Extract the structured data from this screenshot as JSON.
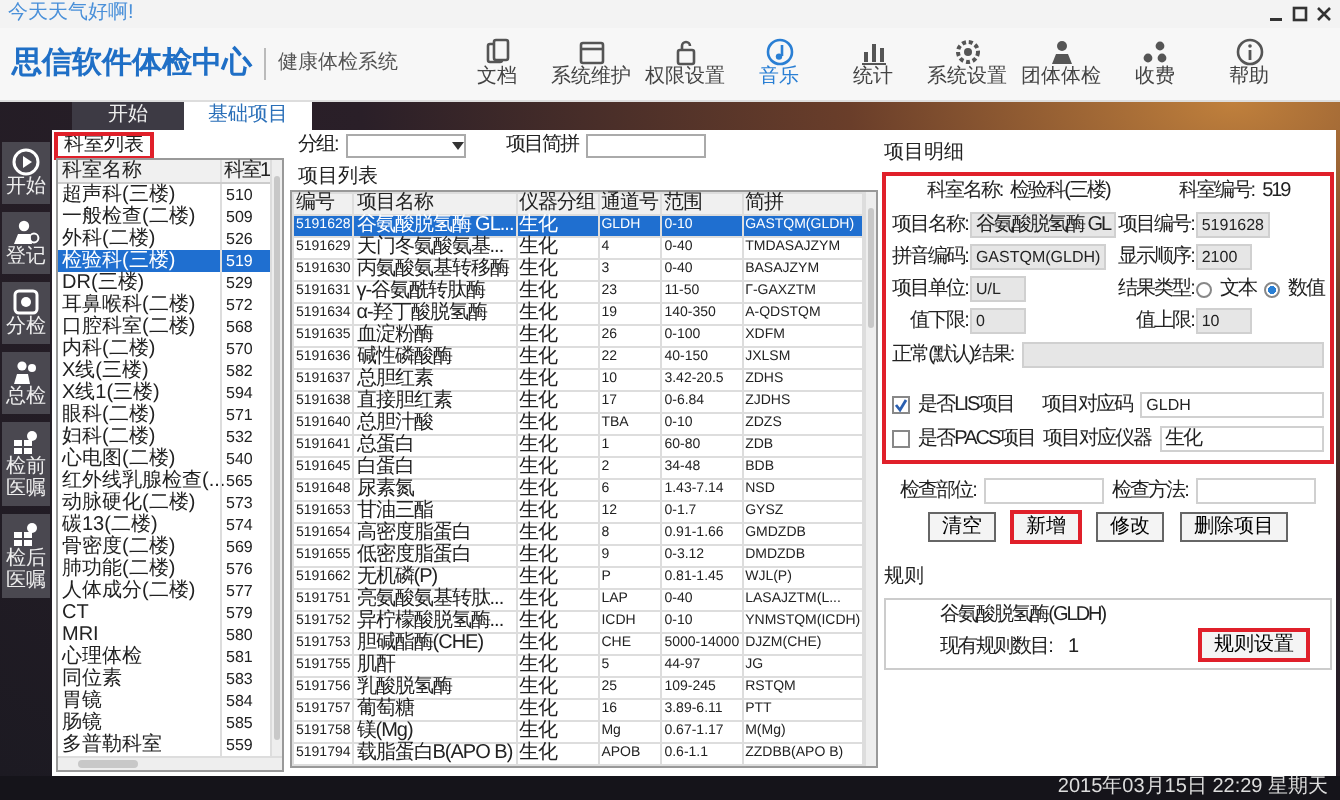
{
  "window": {
    "title": "今天天气好啊!"
  },
  "header": {
    "logo": "思信软件体检中心",
    "subtitle": "健康体检系统"
  },
  "toolbar": [
    {
      "label": "文档",
      "selected": false
    },
    {
      "label": "系统维护",
      "selected": false
    },
    {
      "label": "权限设置",
      "selected": false
    },
    {
      "label": "音乐",
      "selected": true
    },
    {
      "label": "统计",
      "selected": false
    },
    {
      "label": "系统设置",
      "selected": false
    },
    {
      "label": "团体体检",
      "selected": false
    },
    {
      "label": "收费",
      "selected": false
    },
    {
      "label": "帮助",
      "selected": false
    }
  ],
  "tabs": [
    {
      "label": "开始",
      "selected": false
    },
    {
      "label": "基础项目",
      "selected": true
    }
  ],
  "sidebar": [
    {
      "label": "开始"
    },
    {
      "label": "登记"
    },
    {
      "label": "分检"
    },
    {
      "label": "总检"
    },
    {
      "label": "检前医嘱"
    },
    {
      "label": "检后医嘱"
    }
  ],
  "departments": {
    "title": "科室列表",
    "highlighted": true,
    "columns": [
      "科室名称",
      "科室1"
    ],
    "rows": [
      {
        "name": "超声科(三楼)",
        "code": "510",
        "selected": false
      },
      {
        "name": "一般检查(二楼)",
        "code": "509",
        "selected": false
      },
      {
        "name": "外科(二楼)",
        "code": "526",
        "selected": false
      },
      {
        "name": "检验科(三楼)",
        "code": "519",
        "selected": true
      },
      {
        "name": "DR(三楼)",
        "code": "529",
        "selected": false
      },
      {
        "name": "耳鼻喉科(二楼)",
        "code": "572",
        "selected": false
      },
      {
        "name": "口腔科室(二楼)",
        "code": "568",
        "selected": false
      },
      {
        "name": "内科(二楼)",
        "code": "570",
        "selected": false
      },
      {
        "name": "X线(三楼)",
        "code": "582",
        "selected": false
      },
      {
        "name": "X线1(三楼)",
        "code": "594",
        "selected": false
      },
      {
        "name": "眼科(二楼)",
        "code": "571",
        "selected": false
      },
      {
        "name": "妇科(二楼)",
        "code": "532",
        "selected": false
      },
      {
        "name": "心电图(二楼)",
        "code": "540",
        "selected": false
      },
      {
        "name": "红外线乳腺检查(...",
        "code": "565",
        "selected": false
      },
      {
        "name": "动脉硬化(二楼)",
        "code": "573",
        "selected": false
      },
      {
        "name": "碳13(二楼)",
        "code": "574",
        "selected": false
      },
      {
        "name": "骨密度(二楼)",
        "code": "569",
        "selected": false
      },
      {
        "name": "肺功能(二楼)",
        "code": "576",
        "selected": false
      },
      {
        "name": "人体成分(二楼)",
        "code": "577",
        "selected": false
      },
      {
        "name": "CT",
        "code": "579",
        "selected": false
      },
      {
        "name": "MRI",
        "code": "580",
        "selected": false
      },
      {
        "name": "心理体检",
        "code": "581",
        "selected": false
      },
      {
        "name": "同位素",
        "code": "583",
        "selected": false
      },
      {
        "name": "胃镜",
        "code": "584",
        "selected": false
      },
      {
        "name": "肠镜",
        "code": "585",
        "selected": false
      },
      {
        "name": "多普勒科室",
        "code": "559",
        "selected": false
      }
    ]
  },
  "filter": {
    "group_label": "分组:",
    "pinyin_label": "项目简拼"
  },
  "items": {
    "title": "项目列表",
    "columns": [
      "编号",
      "项目名称",
      "仪器分组",
      "通道号",
      "范围",
      "简拼"
    ],
    "rows": [
      {
        "cells": [
          "5191628",
          "谷氨酸脱氢酶 GL...",
          "生化",
          "GLDH",
          "0-10",
          "GASTQM(GLDH)"
        ],
        "selected": true
      },
      {
        "cells": [
          "5191629",
          "天门冬氨酸氨基...",
          "生化",
          "4",
          "0-40",
          "TMDASAJZYM"
        ],
        "selected": false
      },
      {
        "cells": [
          "5191630",
          "丙氨酸氨基转移酶",
          "生化",
          "3",
          "0-40",
          "BASAJZYM"
        ],
        "selected": false
      },
      {
        "cells": [
          "5191631",
          "γ-谷氨酰转肽酶",
          "生化",
          "23",
          "11-50",
          "Γ-GAXZTM"
        ],
        "selected": false
      },
      {
        "cells": [
          "5191634",
          "α-羟丁酸脱氢酶",
          "生化",
          "19",
          "140-350",
          "Α-QDSTQM"
        ],
        "selected": false
      },
      {
        "cells": [
          "5191635",
          "血淀粉酶",
          "生化",
          "26",
          "0-100",
          "XDFM"
        ],
        "selected": false
      },
      {
        "cells": [
          "5191636",
          "碱性磷酸酶",
          "生化",
          "22",
          "40-150",
          "JXLSM"
        ],
        "selected": false
      },
      {
        "cells": [
          "5191637",
          "总胆红素",
          "生化",
          "10",
          "3.42-20.5",
          "ZDHS"
        ],
        "selected": false
      },
      {
        "cells": [
          "5191638",
          "直接胆红素",
          "生化",
          "17",
          "0-6.84",
          "ZJDHS"
        ],
        "selected": false
      },
      {
        "cells": [
          "5191640",
          "总胆汁酸",
          "生化",
          "TBA",
          "0-10",
          "ZDZS"
        ],
        "selected": false
      },
      {
        "cells": [
          "5191641",
          "总蛋白",
          "生化",
          "1",
          "60-80",
          "ZDB"
        ],
        "selected": false
      },
      {
        "cells": [
          "5191645",
          "白蛋白",
          "生化",
          "2",
          "34-48",
          "BDB"
        ],
        "selected": false
      },
      {
        "cells": [
          "5191648",
          "尿素氮",
          "生化",
          "6",
          "1.43-7.14",
          "NSD"
        ],
        "selected": false
      },
      {
        "cells": [
          "5191653",
          "甘油三酯",
          "生化",
          "12",
          "0-1.7",
          "GYSZ"
        ],
        "selected": false
      },
      {
        "cells": [
          "5191654",
          "高密度脂蛋白",
          "生化",
          "8",
          "0.91-1.66",
          "GMDZDB"
        ],
        "selected": false
      },
      {
        "cells": [
          "5191655",
          "低密度脂蛋白",
          "生化",
          "9",
          "0-3.12",
          "DMDZDB"
        ],
        "selected": false
      },
      {
        "cells": [
          "5191662",
          "无机磷(P)",
          "生化",
          "P",
          "0.81-1.45",
          "WJL(P)"
        ],
        "selected": false
      },
      {
        "cells": [
          "5191751",
          "亮氨酸氨基转肽...",
          "生化",
          "LAP",
          "0-40",
          "LASAJZTM(L..."
        ],
        "selected": false
      },
      {
        "cells": [
          "5191752",
          "异柠檬酸脱氢酶...",
          "生化",
          "ICDH",
          "0-10",
          "YNMSTQM(ICDH)"
        ],
        "selected": false
      },
      {
        "cells": [
          "5191753",
          "胆碱酯酶(CHE)",
          "生化",
          "CHE",
          "5000-14000",
          "DJZM(CHE)"
        ],
        "selected": false
      },
      {
        "cells": [
          "5191755",
          "肌酐",
          "生化",
          "5",
          "44-97",
          "JG"
        ],
        "selected": false
      },
      {
        "cells": [
          "5191756",
          "乳酸脱氢酶",
          "生化",
          "25",
          "109-245",
          "RSTQM"
        ],
        "selected": false
      },
      {
        "cells": [
          "5191757",
          "葡萄糖",
          "生化",
          "16",
          "3.89-6.11",
          "PTT"
        ],
        "selected": false
      },
      {
        "cells": [
          "5191758",
          "镁(Mg)",
          "生化",
          "Mg",
          "0.67-1.17",
          "M(Mg)"
        ],
        "selected": false
      },
      {
        "cells": [
          "5191794",
          "载脂蛋白B(APO B)",
          "生化",
          "APOB",
          "0.6-1.1",
          "ZZDBB(APO B)"
        ],
        "selected": false
      }
    ]
  },
  "detail": {
    "title": "项目明细",
    "highlighted": true,
    "dept_name_label": "科室名称:",
    "dept_name": "检验科(三楼)",
    "dept_code_label": "科室编号:",
    "dept_code": "519",
    "fields": [
      {
        "kind": "input",
        "label": "项目名称:",
        "value": "谷氨酸脱氢酶 GL"
      },
      {
        "kind": "input",
        "label": "项目编号:",
        "value": "5191628"
      },
      {
        "kind": "input",
        "label": "拼音编码:",
        "value": "GASTQM(GLDH)"
      },
      {
        "kind": "input",
        "label": "显示顺序:",
        "value": "2100"
      },
      {
        "kind": "input",
        "label": "项目单位:",
        "value": "U/L"
      },
      {
        "kind": "radio",
        "label": "结果类型:",
        "options": [
          {
            "label": "文本",
            "selected": false
          },
          {
            "label": "数值",
            "selected": true
          }
        ]
      },
      {
        "kind": "input",
        "label": "值下限:",
        "value": "0"
      },
      {
        "kind": "input",
        "label": "值上限:",
        "value": "10"
      }
    ],
    "normal_label": "正常(默认)结果:",
    "flags": [
      {
        "label": "是否LIS项目",
        "checked": true,
        "field_label": "项目对应码",
        "value": "GLDH"
      },
      {
        "label": "是否PACS项目",
        "checked": false,
        "field_label": "项目对应仪器",
        "value": "生化"
      }
    ]
  },
  "exam": [
    {
      "label": "检查部位:"
    },
    {
      "label": "检查方法:"
    }
  ],
  "buttons": [
    {
      "label": "清空",
      "highlighted": false
    },
    {
      "label": "新增",
      "highlighted": true
    },
    {
      "label": "修改",
      "highlighted": false
    },
    {
      "label": "删除项目",
      "highlighted": false
    }
  ],
  "rules": {
    "title": "规则",
    "item": "谷氨酸脱氢酶(GLDH)",
    "count_label": "现有规则数目:",
    "count": "1",
    "button": {
      "label": "规则设置",
      "highlighted": true
    }
  },
  "status_bar": "2015年03月15日 22:29 星期天"
}
